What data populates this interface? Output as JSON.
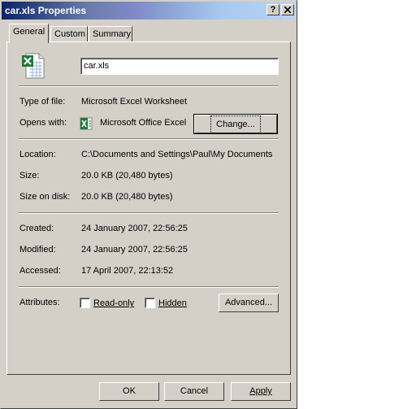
{
  "window": {
    "title": "car.xls Properties",
    "help_btn": "?",
    "close_btn": "X"
  },
  "tabs": [
    {
      "label": "General"
    },
    {
      "label": "Custom"
    },
    {
      "label": "Summary"
    }
  ],
  "general": {
    "filename": "car.xls",
    "type_label": "Type of file:",
    "type_value": "Microsoft Excel Worksheet",
    "opens_label": "Opens with:",
    "opens_value": "Microsoft Office Excel",
    "change_button": "Change...",
    "location_label": "Location:",
    "location_value": "C:\\Documents and Settings\\Paul\\My Documents",
    "size_label": "Size:",
    "size_value": "20.0 KB (20,480 bytes)",
    "size_on_disk_label": "Size on disk:",
    "size_on_disk_value": "20.0 KB (20,480 bytes)",
    "created_label": "Created:",
    "created_value": "24 January 2007, 22:56:25",
    "modified_label": "Modified:",
    "modified_value": "24 January 2007, 22:56:25",
    "accessed_label": "Accessed:",
    "accessed_value": "17 April 2007, 22:13:52",
    "attributes_label": "Attributes:",
    "readonly_label": "Read-only",
    "readonly_checked": false,
    "hidden_label": "Hidden",
    "hidden_checked": false,
    "advanced_button": "Advanced..."
  },
  "footer": {
    "ok": "OK",
    "cancel": "Cancel",
    "apply": "Apply"
  },
  "icons": {
    "file": "excel-file-icon",
    "app": "excel-app-icon"
  }
}
